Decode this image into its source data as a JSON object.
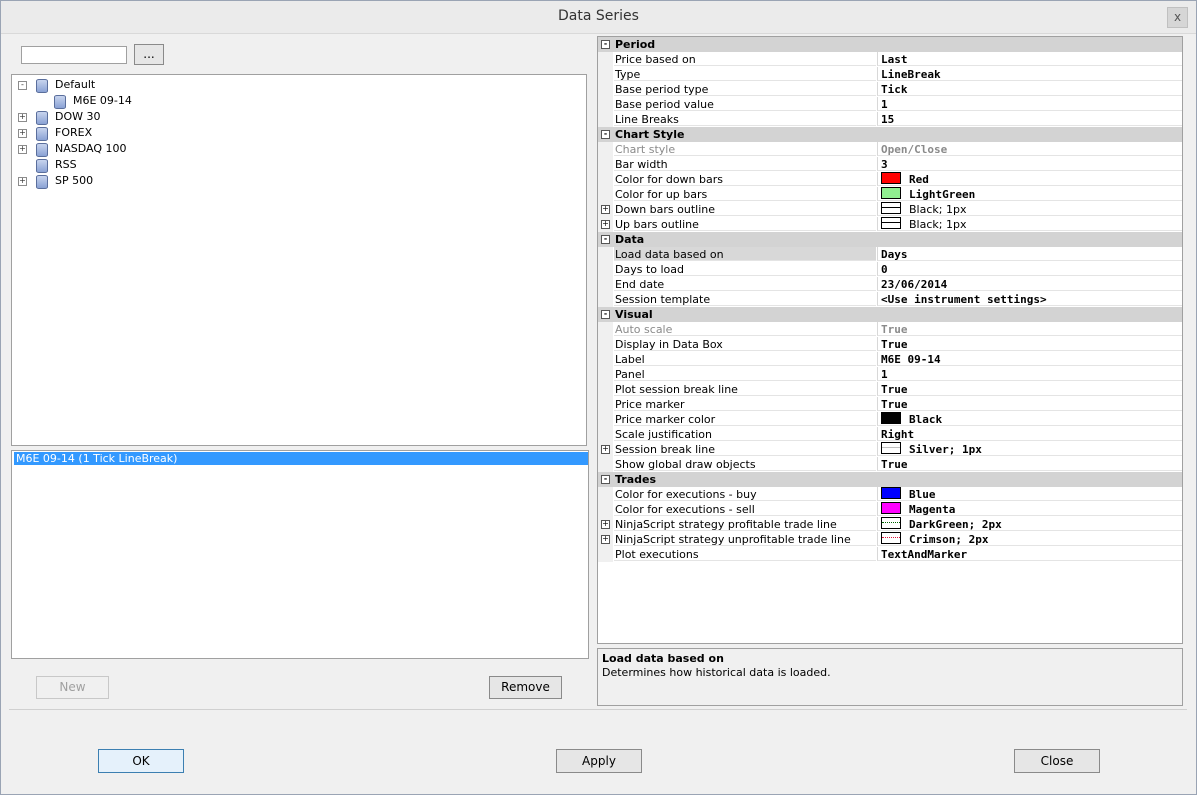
{
  "window": {
    "title": "Data Series",
    "close_glyph": "x"
  },
  "search": {
    "placeholder": "",
    "browse_label": "..."
  },
  "tree": {
    "items": [
      {
        "label": "Default",
        "expanded": true
      },
      {
        "label": "M6E 09-14",
        "child": true
      },
      {
        "label": "DOW 30"
      },
      {
        "label": "FOREX"
      },
      {
        "label": "NASDAQ 100"
      },
      {
        "label": "RSS"
      },
      {
        "label": "SP 500"
      }
    ]
  },
  "series_list": {
    "selected": "M6E 09-14 (1 Tick LineBreak)"
  },
  "buttons": {
    "new": "New",
    "remove": "Remove",
    "ok": "OK",
    "apply": "Apply",
    "close": "Close"
  },
  "properties": {
    "period": {
      "title": "Period",
      "price_based_on": {
        "name": "Price based on",
        "value": "Last"
      },
      "type": {
        "name": "Type",
        "value": "LineBreak"
      },
      "base_period_type": {
        "name": "Base period type",
        "value": "Tick"
      },
      "base_period_value": {
        "name": "Base period value",
        "value": "1"
      },
      "line_breaks": {
        "name": "Line Breaks",
        "value": "15"
      }
    },
    "chart_style": {
      "title": "Chart Style",
      "chart_style": {
        "name": "Chart style",
        "value": "Open/Close"
      },
      "bar_width": {
        "name": "Bar width",
        "value": "3"
      },
      "down_color": {
        "name": "Color for down bars",
        "value": "Red",
        "color": "#ff0000"
      },
      "up_color": {
        "name": "Color for up bars",
        "value": "LightGreen",
        "color": "#90ee90"
      },
      "down_outline": {
        "name": "Down bars outline",
        "value": "Black; 1px"
      },
      "up_outline": {
        "name": "Up bars outline",
        "value": "Black; 1px"
      }
    },
    "data": {
      "title": "Data",
      "load_based_on": {
        "name": "Load data based on",
        "value": "Days"
      },
      "days_to_load": {
        "name": "Days to load",
        "value": "0"
      },
      "end_date": {
        "name": "End date",
        "value": "23/06/2014"
      },
      "session_template": {
        "name": "Session template",
        "value": "<Use instrument settings>"
      }
    },
    "visual": {
      "title": "Visual",
      "auto_scale": {
        "name": "Auto scale",
        "value": "True"
      },
      "display_data_box": {
        "name": "Display in Data Box",
        "value": "True"
      },
      "label": {
        "name": "Label",
        "value": "M6E 09-14"
      },
      "panel": {
        "name": "Panel",
        "value": "1"
      },
      "plot_session_break": {
        "name": "Plot session break line",
        "value": "True"
      },
      "price_marker": {
        "name": "Price marker",
        "value": "True"
      },
      "price_marker_color": {
        "name": "Price marker color",
        "value": "Black",
        "color": "#000000"
      },
      "scale_justification": {
        "name": "Scale justification",
        "value": "Right"
      },
      "session_break_line": {
        "name": "Session break line",
        "value": "Silver; 1px"
      },
      "show_global_draw": {
        "name": "Show global draw objects",
        "value": "True"
      }
    },
    "trades": {
      "title": "Trades",
      "exec_buy": {
        "name": "Color for executions - buy",
        "value": "Blue",
        "color": "#0000ff"
      },
      "exec_sell": {
        "name": "Color for executions - sell",
        "value": "Magenta",
        "color": "#ff00ff"
      },
      "profit_line": {
        "name": "NinjaScript strategy profitable trade line",
        "value": "DarkGreen; 2px",
        "color": "#006400"
      },
      "unprofit_line": {
        "name": "NinjaScript strategy unprofitable trade line",
        "value": "Crimson; 2px",
        "color": "#dc143c"
      },
      "plot_exec": {
        "name": "Plot executions",
        "value": "TextAndMarker"
      }
    }
  },
  "help": {
    "title": "Load data based on",
    "text": "Determines how historical data is loaded."
  },
  "colors": {
    "selection": "#3399ff",
    "category_bg": "#d3d3d3"
  }
}
